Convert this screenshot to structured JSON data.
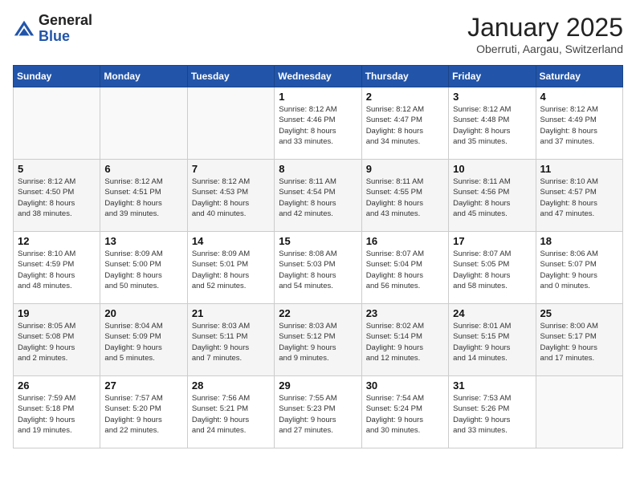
{
  "header": {
    "logo_general": "General",
    "logo_blue": "Blue",
    "month_title": "January 2025",
    "location": "Oberruti, Aargau, Switzerland"
  },
  "days_of_week": [
    "Sunday",
    "Monday",
    "Tuesday",
    "Wednesday",
    "Thursday",
    "Friday",
    "Saturday"
  ],
  "weeks": [
    [
      {
        "day": "",
        "info": ""
      },
      {
        "day": "",
        "info": ""
      },
      {
        "day": "",
        "info": ""
      },
      {
        "day": "1",
        "info": "Sunrise: 8:12 AM\nSunset: 4:46 PM\nDaylight: 8 hours\nand 33 minutes."
      },
      {
        "day": "2",
        "info": "Sunrise: 8:12 AM\nSunset: 4:47 PM\nDaylight: 8 hours\nand 34 minutes."
      },
      {
        "day": "3",
        "info": "Sunrise: 8:12 AM\nSunset: 4:48 PM\nDaylight: 8 hours\nand 35 minutes."
      },
      {
        "day": "4",
        "info": "Sunrise: 8:12 AM\nSunset: 4:49 PM\nDaylight: 8 hours\nand 37 minutes."
      }
    ],
    [
      {
        "day": "5",
        "info": "Sunrise: 8:12 AM\nSunset: 4:50 PM\nDaylight: 8 hours\nand 38 minutes."
      },
      {
        "day": "6",
        "info": "Sunrise: 8:12 AM\nSunset: 4:51 PM\nDaylight: 8 hours\nand 39 minutes."
      },
      {
        "day": "7",
        "info": "Sunrise: 8:12 AM\nSunset: 4:53 PM\nDaylight: 8 hours\nand 40 minutes."
      },
      {
        "day": "8",
        "info": "Sunrise: 8:11 AM\nSunset: 4:54 PM\nDaylight: 8 hours\nand 42 minutes."
      },
      {
        "day": "9",
        "info": "Sunrise: 8:11 AM\nSunset: 4:55 PM\nDaylight: 8 hours\nand 43 minutes."
      },
      {
        "day": "10",
        "info": "Sunrise: 8:11 AM\nSunset: 4:56 PM\nDaylight: 8 hours\nand 45 minutes."
      },
      {
        "day": "11",
        "info": "Sunrise: 8:10 AM\nSunset: 4:57 PM\nDaylight: 8 hours\nand 47 minutes."
      }
    ],
    [
      {
        "day": "12",
        "info": "Sunrise: 8:10 AM\nSunset: 4:59 PM\nDaylight: 8 hours\nand 48 minutes."
      },
      {
        "day": "13",
        "info": "Sunrise: 8:09 AM\nSunset: 5:00 PM\nDaylight: 8 hours\nand 50 minutes."
      },
      {
        "day": "14",
        "info": "Sunrise: 8:09 AM\nSunset: 5:01 PM\nDaylight: 8 hours\nand 52 minutes."
      },
      {
        "day": "15",
        "info": "Sunrise: 8:08 AM\nSunset: 5:03 PM\nDaylight: 8 hours\nand 54 minutes."
      },
      {
        "day": "16",
        "info": "Sunrise: 8:07 AM\nSunset: 5:04 PM\nDaylight: 8 hours\nand 56 minutes."
      },
      {
        "day": "17",
        "info": "Sunrise: 8:07 AM\nSunset: 5:05 PM\nDaylight: 8 hours\nand 58 minutes."
      },
      {
        "day": "18",
        "info": "Sunrise: 8:06 AM\nSunset: 5:07 PM\nDaylight: 9 hours\nand 0 minutes."
      }
    ],
    [
      {
        "day": "19",
        "info": "Sunrise: 8:05 AM\nSunset: 5:08 PM\nDaylight: 9 hours\nand 2 minutes."
      },
      {
        "day": "20",
        "info": "Sunrise: 8:04 AM\nSunset: 5:09 PM\nDaylight: 9 hours\nand 5 minutes."
      },
      {
        "day": "21",
        "info": "Sunrise: 8:03 AM\nSunset: 5:11 PM\nDaylight: 9 hours\nand 7 minutes."
      },
      {
        "day": "22",
        "info": "Sunrise: 8:03 AM\nSunset: 5:12 PM\nDaylight: 9 hours\nand 9 minutes."
      },
      {
        "day": "23",
        "info": "Sunrise: 8:02 AM\nSunset: 5:14 PM\nDaylight: 9 hours\nand 12 minutes."
      },
      {
        "day": "24",
        "info": "Sunrise: 8:01 AM\nSunset: 5:15 PM\nDaylight: 9 hours\nand 14 minutes."
      },
      {
        "day": "25",
        "info": "Sunrise: 8:00 AM\nSunset: 5:17 PM\nDaylight: 9 hours\nand 17 minutes."
      }
    ],
    [
      {
        "day": "26",
        "info": "Sunrise: 7:59 AM\nSunset: 5:18 PM\nDaylight: 9 hours\nand 19 minutes."
      },
      {
        "day": "27",
        "info": "Sunrise: 7:57 AM\nSunset: 5:20 PM\nDaylight: 9 hours\nand 22 minutes."
      },
      {
        "day": "28",
        "info": "Sunrise: 7:56 AM\nSunset: 5:21 PM\nDaylight: 9 hours\nand 24 minutes."
      },
      {
        "day": "29",
        "info": "Sunrise: 7:55 AM\nSunset: 5:23 PM\nDaylight: 9 hours\nand 27 minutes."
      },
      {
        "day": "30",
        "info": "Sunrise: 7:54 AM\nSunset: 5:24 PM\nDaylight: 9 hours\nand 30 minutes."
      },
      {
        "day": "31",
        "info": "Sunrise: 7:53 AM\nSunset: 5:26 PM\nDaylight: 9 hours\nand 33 minutes."
      },
      {
        "day": "",
        "info": ""
      }
    ]
  ]
}
